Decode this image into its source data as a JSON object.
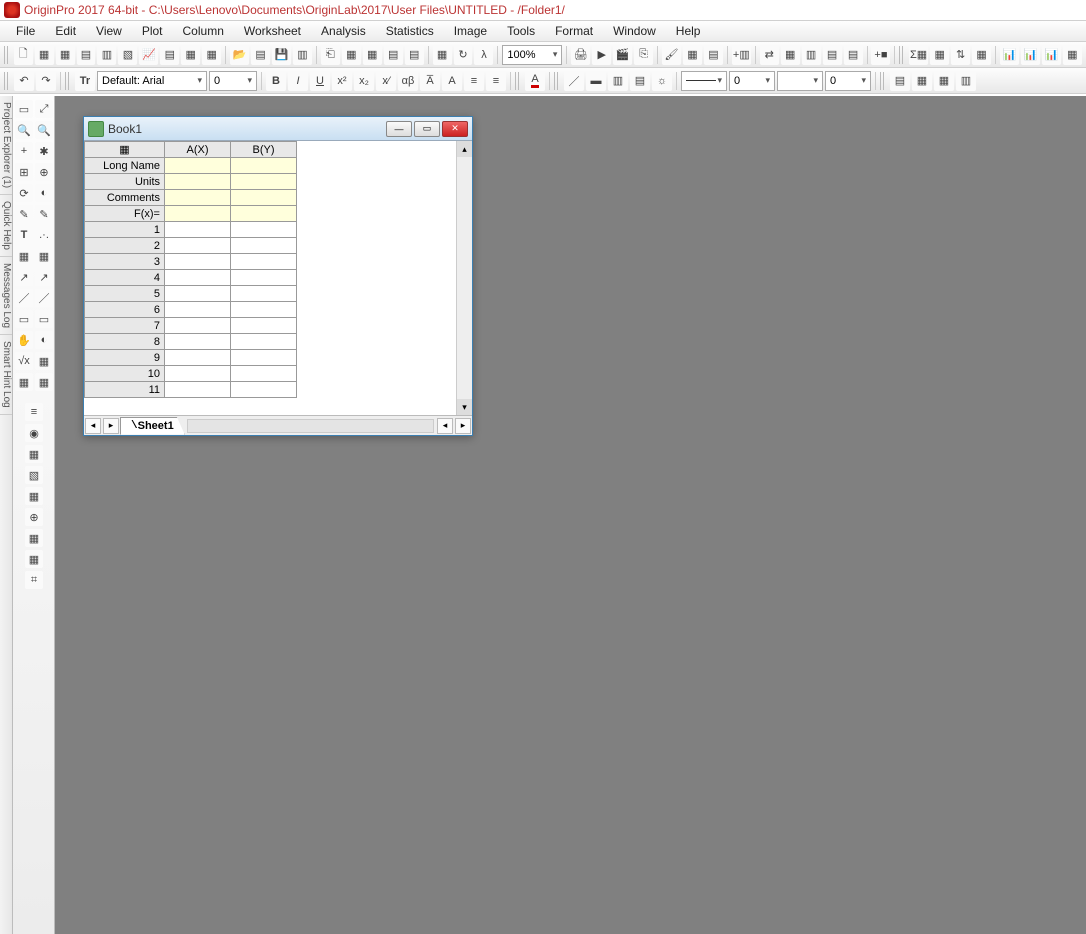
{
  "app": {
    "title": "OriginPro 2017 64-bit - C:\\Users\\Lenovo\\Documents\\OriginLab\\2017\\User Files\\UNTITLED - /Folder1/"
  },
  "menu": [
    "File",
    "Edit",
    "View",
    "Plot",
    "Column",
    "Worksheet",
    "Analysis",
    "Statistics",
    "Image",
    "Tools",
    "Format",
    "Window",
    "Help"
  ],
  "toolbar1": {
    "zoom": "100%"
  },
  "toolbar2": {
    "font_label": "Default: Arial",
    "font_size": "0",
    "num1": "0",
    "num2": "0",
    "num3": "0"
  },
  "left_tabs": [
    "Project Explorer (1)",
    "Quick Help",
    "Messages Log",
    "Smart Hint Log"
  ],
  "book": {
    "title": "Book1",
    "columns": [
      "A(X)",
      "B(Y)"
    ],
    "label_rows": [
      "Long Name",
      "Units",
      "Comments",
      "F(x)="
    ],
    "row_count": 11,
    "sheet_tab": "Sheet1"
  }
}
